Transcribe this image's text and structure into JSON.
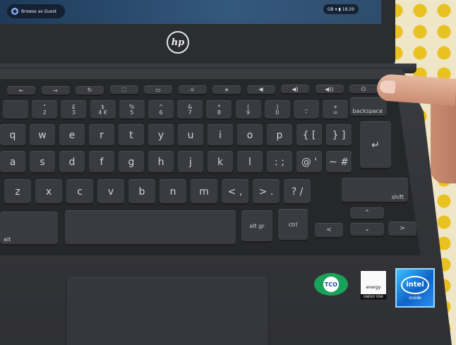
{
  "screen": {
    "guest_label": "Browse as Guest",
    "status_text": "GB ▾ ▮ 18:29"
  },
  "lid": {
    "logo": "hp"
  },
  "keyboard": {
    "function_row": [
      "←",
      "→",
      "↻",
      "⛶",
      "▭",
      "☼",
      "☀",
      "◀",
      "◀)",
      "◀))",
      "⏻"
    ],
    "number_row": [
      {
        "top": "",
        "bot": ""
      },
      {
        "top": "\"",
        "bot": "2"
      },
      {
        "top": "£",
        "bot": "3"
      },
      {
        "top": "$",
        "bot": "4 €"
      },
      {
        "top": "%",
        "bot": "5"
      },
      {
        "top": "^",
        "bot": "6"
      },
      {
        "top": "&",
        "bot": "7"
      },
      {
        "top": "*",
        "bot": "8"
      },
      {
        "top": "(",
        "bot": "9"
      },
      {
        "top": ")",
        "bot": "0"
      },
      {
        "top": "_",
        "bot": "-"
      },
      {
        "top": "+",
        "bot": "="
      }
    ],
    "backspace": "backspace",
    "row_q": [
      "q",
      "w",
      "e",
      "r",
      "t",
      "y",
      "u",
      "i",
      "o",
      "p",
      "{ [",
      "} ]"
    ],
    "row_a": [
      "a",
      "s",
      "d",
      "f",
      "g",
      "h",
      "j",
      "k",
      "l",
      ": ;",
      "@ '",
      "~ #"
    ],
    "enter_icon": "↵",
    "row_z": [
      "z",
      "x",
      "c",
      "v",
      "b",
      "n",
      "m",
      "< ,",
      "> .",
      "? /"
    ],
    "shift": "shift",
    "alt_gr": "alt gr",
    "ctrl": "ctrl",
    "left_alt": "alt",
    "arrows": {
      "up": "⌃",
      "down": "⌄",
      "left": "<",
      "right": ">"
    }
  },
  "stickers": {
    "tco": "TCO",
    "energy_star": "ENERGY STAR",
    "energy_script": "energy",
    "intel": "intel",
    "intel_sub": "inside"
  }
}
